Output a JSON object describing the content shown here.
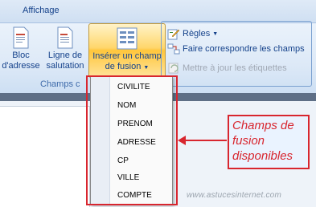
{
  "ribbon": {
    "tab": "Affichage",
    "group_label": "Champs c",
    "buttons": {
      "bloc_line1": "Bloc",
      "bloc_line2": "d'adresse",
      "ligne_line1": "Ligne de",
      "ligne_line2": "salutation",
      "inserer_line1": "Insérer un champ",
      "inserer_line2": "de fusion"
    },
    "small_buttons": {
      "regles": "Règles",
      "faire": "Faire correspondre les champs",
      "maj": "Mettre à jour les étiquettes"
    }
  },
  "menu": {
    "items": [
      "CIVILITE",
      "NOM",
      "PRENOM",
      "ADRESSE",
      "CP",
      "VILLE",
      "COMPTE"
    ]
  },
  "callout": {
    "line1": "Champs de",
    "line2": "fusion",
    "line3": "disponibles"
  },
  "watermark": "www.astucesinternet.com",
  "colors": {
    "highlight_red": "#d8262f",
    "ribbon_text": "#15428b",
    "selected_button": "#ffd66b"
  }
}
